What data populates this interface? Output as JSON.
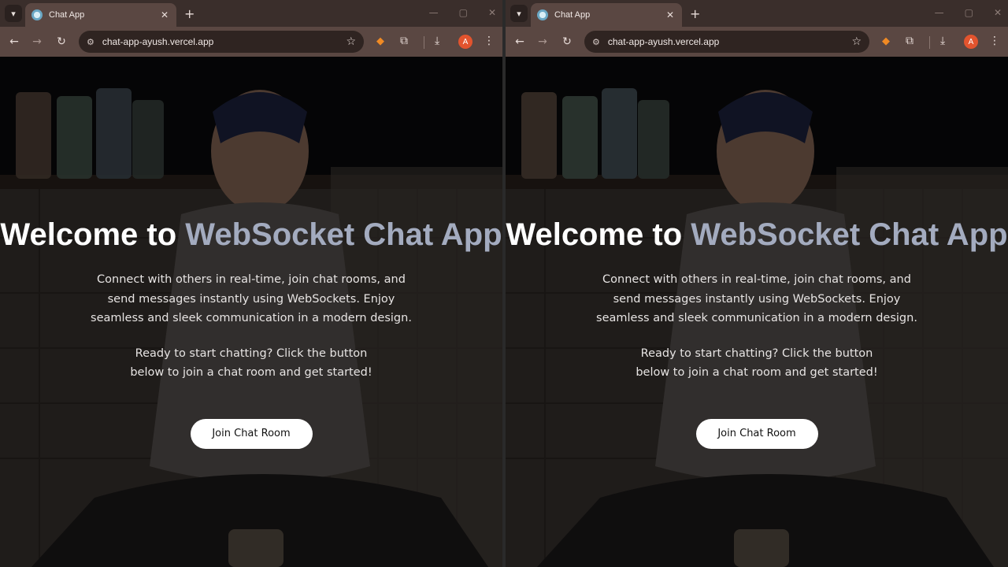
{
  "windows": [
    {
      "tab": {
        "title": "Chat App",
        "close": "✕"
      },
      "new_tab": "+",
      "url": "chat-app-ayush.vercel.app",
      "profile_initial": "A",
      "hero": {
        "title_part1": "Welcome to ",
        "title_accent": "WebSocket Chat App",
        "description": "Connect with others in real-time, join chat rooms, and send messages instantly using WebSockets. Enjoy seamless and sleek communication in a modern design.",
        "cta_text": "Ready to start chatting? Click the button below to join a chat room and get started!",
        "button_label": "Join Chat Room"
      }
    },
    {
      "tab": {
        "title": "Chat App",
        "close": "✕"
      },
      "new_tab": "+",
      "url": "chat-app-ayush.vercel.app",
      "profile_initial": "A",
      "hero": {
        "title_part1": "Welcome to ",
        "title_accent": "WebSocket Chat App",
        "description": "Connect with others in real-time, join chat rooms, and send messages instantly using WebSockets. Enjoy seamless and sleek communication in a modern design.",
        "cta_text": "Ready to start chatting? Click the button below to join a chat room and get started!",
        "button_label": "Join Chat Room"
      }
    }
  ],
  "icons": {
    "tab_search": "chevron-down-icon",
    "back": "arrow-left-icon",
    "forward": "arrow-right-icon",
    "reload": "reload-icon",
    "site_info": "tune-icon",
    "bookmark": "star-icon",
    "extension_fox": "metamask-fox-icon",
    "extensions": "puzzle-icon",
    "downloads": "download-icon",
    "menu": "kebab-menu-icon"
  },
  "colors": {
    "tab_bar": "#3a2e2b",
    "toolbar": "#5a4742",
    "accent_title": "#a3abbf",
    "button_bg": "#ffffff",
    "profile": "#e2542e"
  }
}
